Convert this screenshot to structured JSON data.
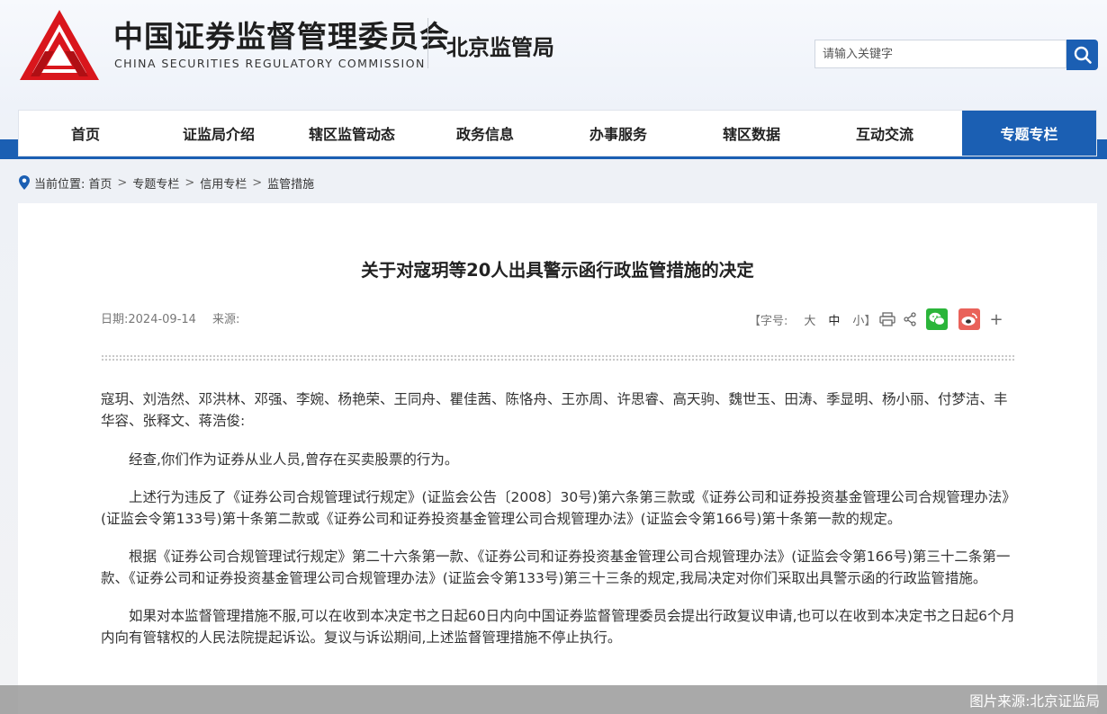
{
  "header": {
    "org_name_cn": "中国证券监督管理委员会",
    "org_name_en": "CHINA SECURITIES REGULATORY COMMISSION",
    "bureau_name": "北京监管局",
    "search_placeholder": "请输入关键字"
  },
  "nav": {
    "items": [
      {
        "label": "首页"
      },
      {
        "label": "证监局介绍"
      },
      {
        "label": "辖区监管动态"
      },
      {
        "label": "政务信息"
      },
      {
        "label": "办事服务"
      },
      {
        "label": "辖区数据"
      },
      {
        "label": "互动交流"
      },
      {
        "label": "专题专栏",
        "active": true
      }
    ],
    "active_color": "#1b5fb3"
  },
  "breadcrumb": {
    "prefix": "当前位置:",
    "items": [
      "首页",
      "专题专栏",
      "信用专栏",
      "监管措施"
    ],
    "separator": ">"
  },
  "article": {
    "title": "关于对寇玥等20人出具警示函行政监管措施的决定",
    "date_label": "日期:",
    "date": "2024-09-14",
    "source_label": "来源:",
    "font_size_label": "【字号:",
    "font_sizes": [
      "大",
      "中",
      "小"
    ],
    "font_size_close": "】",
    "share_more": "+",
    "paragraphs": [
      "寇玥、刘浩然、邓洪林、邓强、李婉、杨艳荣、王同舟、瞿佳茜、陈恪舟、王亦周、许思睿、高天驹、魏世玉、田涛、季显明、杨小丽、付梦洁、丰华容、张释文、蒋浩俊:",
      "经查,你们作为证券从业人员,曾存在买卖股票的行为。",
      "上述行为违反了《证券公司合规管理试行规定》(证监会公告〔2008〕30号)第六条第三款或《证券公司和证券投资基金管理公司合规管理办法》(证监会令第133号)第十条第二款或《证券公司和证券投资基金管理公司合规管理办法》(证监会令第166号)第十条第一款的规定。",
      "根据《证券公司合规管理试行规定》第二十六条第一款、《证券公司和证券投资基金管理公司合规管理办法》(证监会令第166号)第三十二条第一款、《证券公司和证券投资基金管理公司合规管理办法》(证监会令第133号)第三十三条的规定,我局决定对你们采取出具警示函的行政监管措施。",
      "如果对本监督管理措施不服,可以在收到本决定书之日起60日内向中国证券监督管理委员会提出行政复议申请,也可以在收到本决定书之日起6个月内向有管辖权的人民法院提起诉讼。复议与诉讼期间,上述监督管理措施不停止执行。"
    ]
  },
  "image_credit": "图片来源:北京证监局",
  "icons": {
    "logo": "csrc-logo-icon",
    "search": "search-icon",
    "location": "location-pin-icon",
    "print": "print-icon",
    "share": "share-icon",
    "wechat": "wechat-icon",
    "weibo": "weibo-icon"
  },
  "colors": {
    "brand_blue": "#1b5fb3",
    "logo_red": "#d9161c",
    "wechat_green": "#2bb53a",
    "weibo_red": "#e9625a"
  }
}
